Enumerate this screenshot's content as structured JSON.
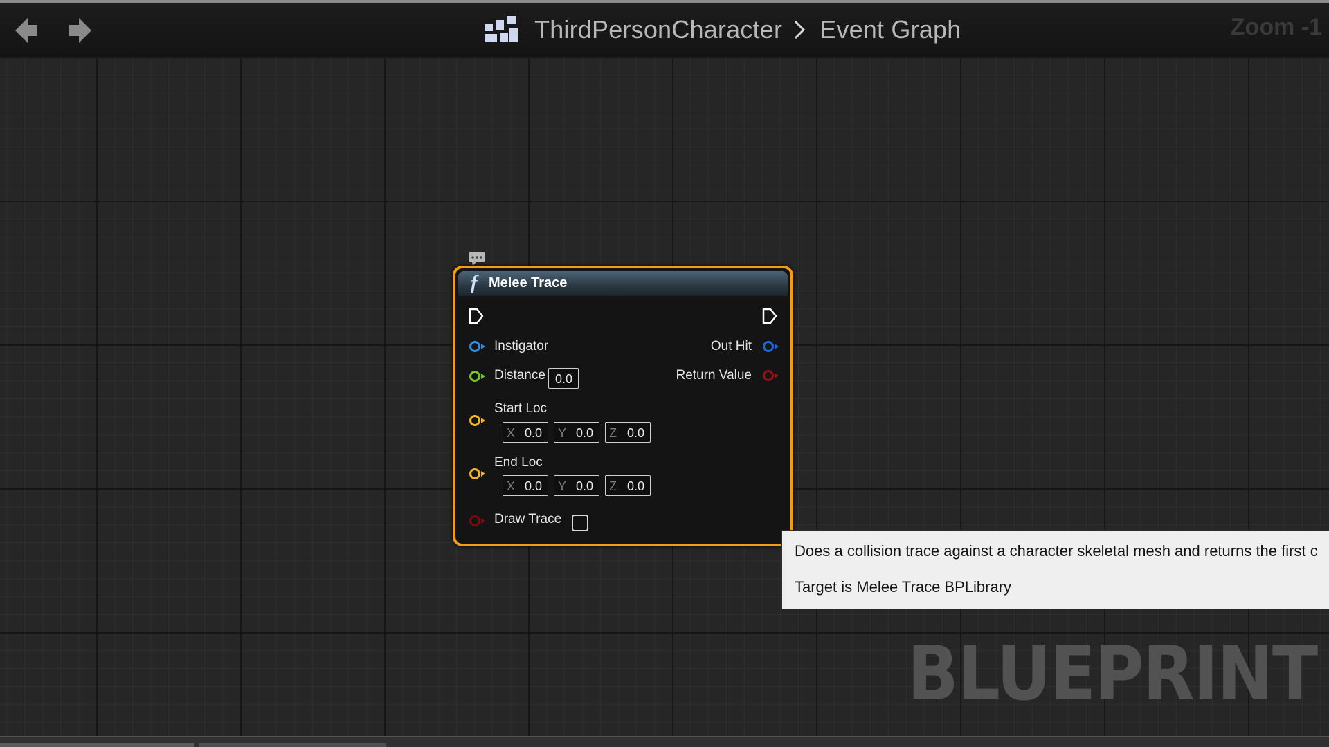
{
  "header": {
    "breadcrumb": [
      "ThirdPersonCharacter",
      "Event Graph"
    ],
    "zoom": "Zoom -1"
  },
  "watermark": "BLUEPRINT",
  "node": {
    "title": "Melee Trace",
    "function_icon": "f",
    "inputs": {
      "instigator": "Instigator",
      "distance": {
        "label": "Distance",
        "value": "0.0"
      },
      "start_loc": {
        "label": "Start Loc",
        "x": "0.0",
        "y": "0.0",
        "z": "0.0"
      },
      "end_loc": {
        "label": "End Loc",
        "x": "0.0",
        "y": "0.0",
        "z": "0.0"
      },
      "draw_trace": {
        "label": "Draw Trace",
        "checked": false
      }
    },
    "outputs": {
      "out_hit": "Out Hit",
      "return_value": "Return Value"
    },
    "axis_labels": {
      "x": "X",
      "y": "Y",
      "z": "Z"
    }
  },
  "tooltip": {
    "line1": "Does a collision trace against a character skeletal mesh and returns the first c",
    "line2": "Target is Melee Trace BPLibrary"
  },
  "colors": {
    "node_border": "#f39b11",
    "pin_object": "#2b8fe0",
    "pin_float": "#6fcb21",
    "pin_vector": "#f0b81a",
    "pin_bool": "#9a0f0f"
  }
}
